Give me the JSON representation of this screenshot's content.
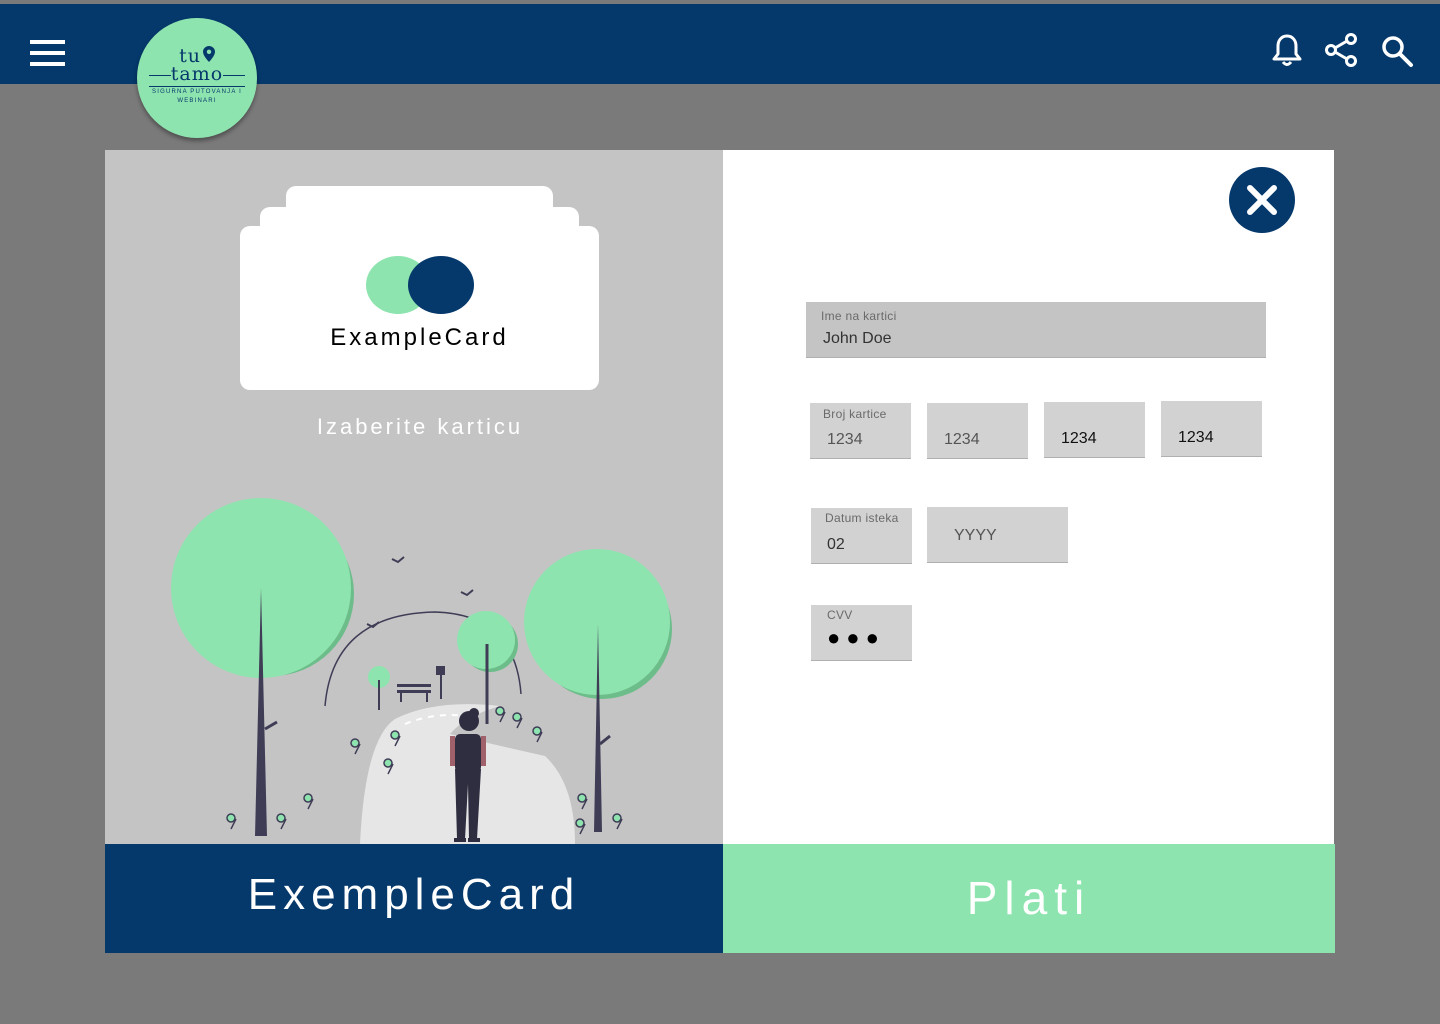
{
  "header": {
    "icons": [
      "menu-icon",
      "bell-icon",
      "share-icon",
      "search-icon"
    ],
    "logo": {
      "line1": "tu",
      "line2": "tamo",
      "tagline": "SIGURNA PUTOVANJA I WEBINARI"
    }
  },
  "card_selector": {
    "card_name": "ExampleCard",
    "choose_label": "Izaberite karticu"
  },
  "form": {
    "name_field": {
      "label": "Ime na kartici",
      "value": "John Doe"
    },
    "card_number": {
      "label": "Broj kartice",
      "groups": [
        {
          "placeholder": "1234"
        },
        {
          "placeholder": "1234"
        },
        {
          "placeholder": "1234"
        },
        {
          "placeholder": "1234"
        }
      ]
    },
    "expiry": {
      "label": "Datum isteka",
      "month_value": "02",
      "year_placeholder": "YYYY"
    },
    "cvv": {
      "label": "CVV",
      "masked_value": "●●●"
    }
  },
  "footer": {
    "selected_card": "ExempleCard",
    "pay_label": "Plati"
  },
  "colors": {
    "primary": "#05386b",
    "accent": "#8ee4af",
    "accent_dark": "#6dbd8b",
    "overlay": "#7a7a7a",
    "panel_grey": "#c4c4c4"
  }
}
